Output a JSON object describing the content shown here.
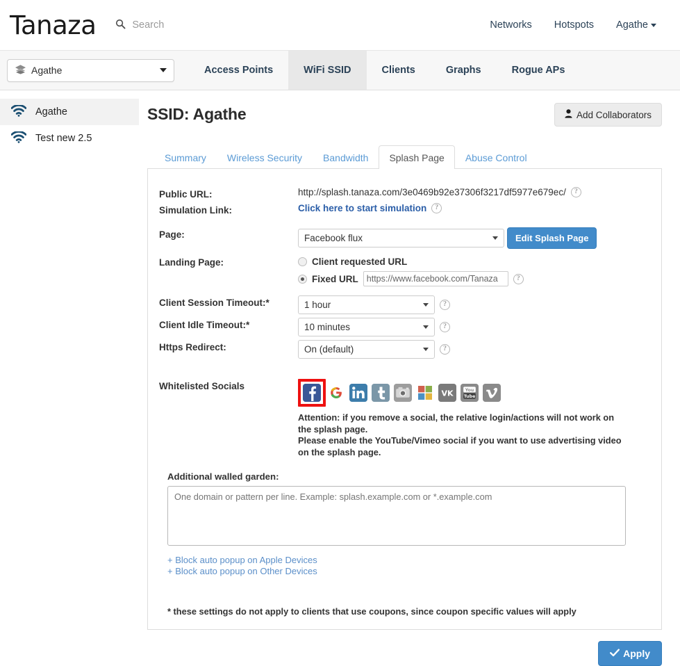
{
  "header": {
    "brand": "Tanaza",
    "search_placeholder": "Search",
    "search_icon": "search-icon",
    "nav": [
      {
        "label": "Networks"
      },
      {
        "label": "Hotspots"
      },
      {
        "label": "Agathe",
        "has_caret": true
      }
    ]
  },
  "subbar": {
    "network_selector": {
      "value": "Agathe",
      "icon": "layers-stack-icon"
    },
    "tabs": [
      {
        "label": "Access Points",
        "active": false
      },
      {
        "label": "WiFi SSID",
        "active": true
      },
      {
        "label": "Clients",
        "active": false
      },
      {
        "label": "Graphs",
        "active": false
      },
      {
        "label": "Rogue APs",
        "active": false
      }
    ]
  },
  "sidebar": {
    "items": [
      {
        "label": "Agathe",
        "icon": "wifi-icon",
        "active": true
      },
      {
        "label": "Test new 2.5",
        "icon": "wifi-icon",
        "active": false
      }
    ]
  },
  "page": {
    "title": "SSID: Agathe",
    "collaborators_button": "Add Collaborators",
    "collaborators_icon": "user-icon"
  },
  "tabs": [
    {
      "label": "Summary",
      "active": false
    },
    {
      "label": "Wireless Security",
      "active": false
    },
    {
      "label": "Bandwidth",
      "active": false
    },
    {
      "label": "Splash Page",
      "active": true
    },
    {
      "label": "Abuse Control",
      "active": false
    }
  ],
  "form": {
    "public_url_label": "Public URL:",
    "public_url_value": "http://splash.tanaza.com/3e0469b92e37306f3217df5977e679ec/",
    "simulation_label": "Simulation Link:",
    "simulation_link": "Click here to start simulation",
    "page_label": "Page:",
    "page_value": "Facebook flux",
    "edit_splash_button": "Edit Splash Page",
    "landing_label": "Landing Page:",
    "landing_option_client": "Client requested URL",
    "landing_option_fixed": "Fixed URL",
    "landing_selected": "fixed",
    "fixed_url_value": "https://www.facebook.com/Tanaza",
    "session_timeout_label": "Client Session Timeout:*",
    "session_timeout_value": "1 hour",
    "idle_timeout_label": "Client Idle Timeout:*",
    "idle_timeout_value": "10 minutes",
    "https_redirect_label": "Https Redirect:",
    "https_redirect_value": "On (default)",
    "socials_label": "Whitelisted Socials",
    "socials": [
      {
        "name": "facebook",
        "glyph": "f",
        "selected": true
      },
      {
        "name": "google-plus",
        "glyph": "g",
        "selected": false
      },
      {
        "name": "linkedin",
        "glyph": "in",
        "selected": false
      },
      {
        "name": "twitter",
        "glyph": "t",
        "selected": false
      },
      {
        "name": "instagram",
        "glyph": "camera",
        "selected": false
      },
      {
        "name": "microsoft",
        "glyph": "squares",
        "selected": false
      },
      {
        "name": "vkontakte",
        "glyph": "VK",
        "selected": false
      },
      {
        "name": "youtube",
        "glyph": "You Tube",
        "selected": false
      },
      {
        "name": "vimeo",
        "glyph": "v",
        "selected": false
      }
    ],
    "attention_line1": "Attention: if you remove a social, the relative login/actions will not work on the splash page.",
    "attention_line2": "Please enable the YouTube/Vimeo social if you want to use advertising video on the splash page.",
    "walled_garden_label": "Additional walled garden:",
    "walled_garden_placeholder": "One domain or pattern per line. Example: splash.example.com or *.example.com",
    "walled_garden_value": "",
    "block_apple_link": "+ Block auto popup on Apple Devices",
    "block_other_link": "+ Block auto popup on Other Devices",
    "footnote": "* these settings do not apply to clients that use coupons, since coupon specific values will apply"
  },
  "apply": {
    "label": "Apply",
    "icon": "check-icon"
  },
  "colors": {
    "primary_blue": "#428bca",
    "link_blue": "#5b9bd5",
    "nav_dark": "#2b4257",
    "selected_outline_red": "#ee1111",
    "facebook_blue": "#3a5897"
  }
}
